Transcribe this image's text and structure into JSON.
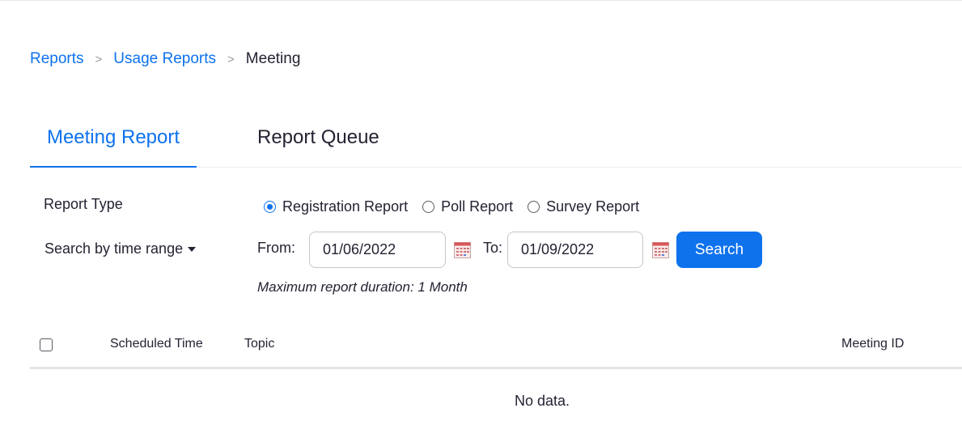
{
  "breadcrumb": {
    "items": [
      "Reports",
      "Usage Reports"
    ],
    "separator": ">",
    "current": "Meeting"
  },
  "tabs": {
    "active": "Meeting Report",
    "inactive": "Report Queue"
  },
  "filters": {
    "report_type_label": "Report Type",
    "report_types": [
      {
        "label": "Registration Report",
        "checked": true
      },
      {
        "label": "Poll Report",
        "checked": false
      },
      {
        "label": "Survey Report",
        "checked": false
      }
    ],
    "time_range_label": "Search by time range",
    "from_label": "From:",
    "from_value": "01/06/2022",
    "to_label": "To:",
    "to_value": "01/09/2022",
    "search_label": "Search",
    "hint": "Maximum report duration: 1 Month"
  },
  "table": {
    "columns": [
      "Scheduled Time",
      "Topic",
      "Meeting ID"
    ],
    "empty_text": "No data."
  },
  "colors": {
    "accent": "#0e72ed",
    "text": "#232333"
  },
  "icons": {
    "calendar": "calendar-icon",
    "caret": "caret-down-icon"
  }
}
